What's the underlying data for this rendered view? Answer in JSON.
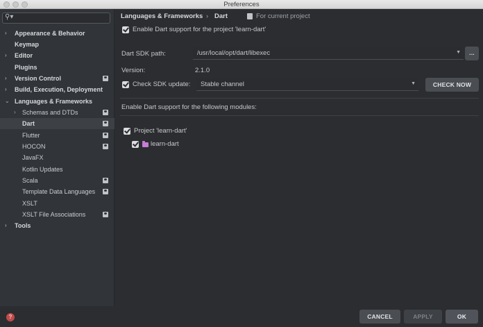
{
  "window": {
    "title": "Preferences"
  },
  "search": {
    "value": "",
    "placeholder": ""
  },
  "sidebar": {
    "items": [
      {
        "label": "Appearance & Behavior",
        "arrow": "›",
        "bold": true
      },
      {
        "label": "Keymap",
        "arrow": "",
        "bold": true
      },
      {
        "label": "Editor",
        "arrow": "›",
        "bold": true
      },
      {
        "label": "Plugins",
        "arrow": "",
        "bold": true
      },
      {
        "label": "Version Control",
        "arrow": "›",
        "bold": true,
        "project": true
      },
      {
        "label": "Build, Execution, Deployment",
        "arrow": "›",
        "bold": true
      },
      {
        "label": "Languages & Frameworks",
        "arrow": "⌄",
        "bold": true
      },
      {
        "label": "Schemas and DTDs",
        "arrow": "›",
        "project": true
      },
      {
        "label": "Dart",
        "project": true,
        "selected": true
      },
      {
        "label": "Flutter",
        "project": true
      },
      {
        "label": "HOCON",
        "project": true
      },
      {
        "label": "JavaFX"
      },
      {
        "label": "Kotlin Updates"
      },
      {
        "label": "Scala",
        "project": true
      },
      {
        "label": "Template Data Languages",
        "project": true
      },
      {
        "label": "XSLT"
      },
      {
        "label": "XSLT File Associations",
        "project": true
      },
      {
        "label": "Tools",
        "arrow": "›",
        "bold": true
      }
    ]
  },
  "breadcrumb": {
    "parent": "Languages & Frameworks",
    "separator": "›",
    "current": "Dart",
    "scope": "For current project"
  },
  "main": {
    "enable_dart_label": "Enable Dart support for the project 'learn-dart'",
    "sdk_path_label": "Dart SDK path:",
    "sdk_path_value": "/usr/local/opt/dart/libexec",
    "browse_label": "...",
    "version_label": "Version:",
    "version_value": "2.1.0",
    "check_update_label": "Check SDK update:",
    "channel_value": "Stable channel",
    "check_now_label": "CHECK NOW",
    "modules_heading": "Enable Dart support for the following modules:",
    "project_node": "Project 'learn-dart'",
    "module_node": "learn-dart"
  },
  "footer": {
    "cancel_label": "CANCEL",
    "apply_label": "APPLY",
    "ok_label": "OK",
    "help_glyph": "?"
  }
}
